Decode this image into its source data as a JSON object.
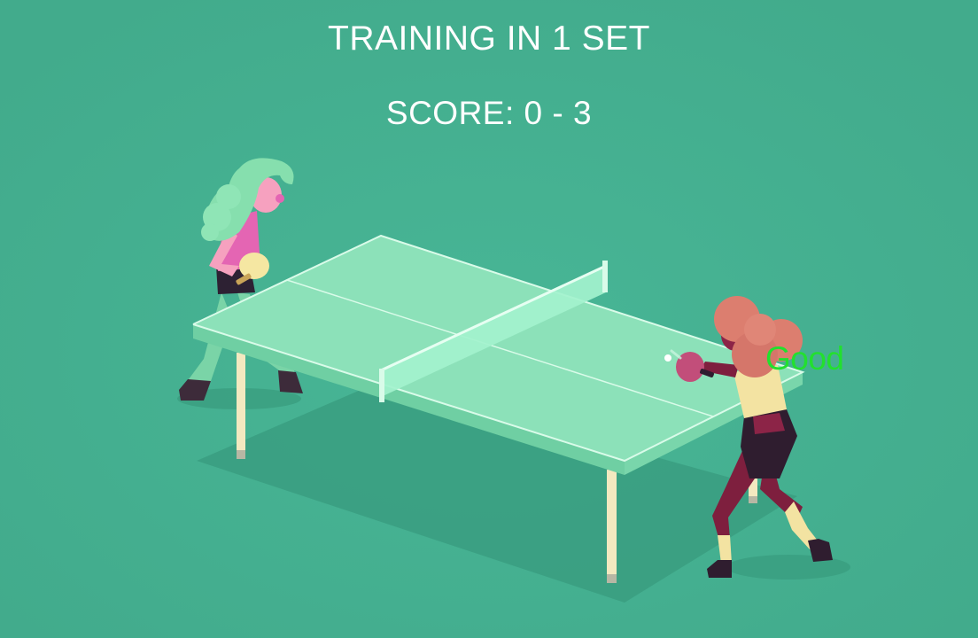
{
  "hud": {
    "title": "TRAINING IN 1 SET",
    "score_text": "SCORE: 0 - 3"
  },
  "feedback": {
    "text": "Good",
    "color": "#22e02e"
  },
  "colors": {
    "background": "#45b192",
    "table_top": "#8ce1b9",
    "table_edge": "#6fcfa3",
    "net": "#a3f2cd",
    "opponent_hair": "#86dfae",
    "opponent_top": "#e465b3",
    "opponent_paddle": "#f5e7a2",
    "player_hair": "#dc7e6f",
    "player_top": "#f3e3a2",
    "player_pants": "#7e1f3e",
    "player_paddle": "#c24e7a"
  }
}
